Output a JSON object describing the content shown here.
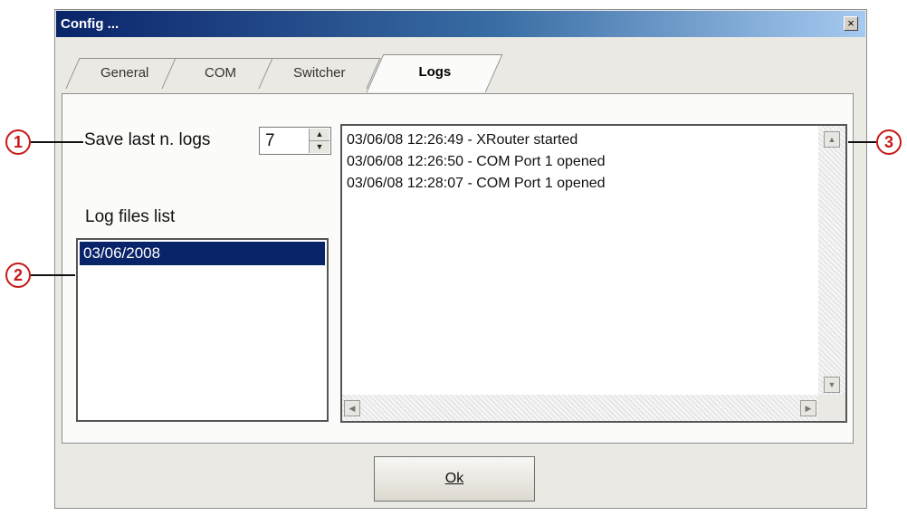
{
  "window": {
    "title": "Config ...",
    "close_glyph": "×"
  },
  "tabs": [
    {
      "label": "General",
      "active": false
    },
    {
      "label": "COM",
      "active": false
    },
    {
      "label": "Switcher",
      "active": false
    },
    {
      "label": "Logs",
      "active": true
    }
  ],
  "logs_tab": {
    "save_last_label": "Save last n. logs",
    "save_last_value": "7",
    "log_files_label": "Log files list",
    "log_files": [
      {
        "label": "03/06/2008",
        "selected": true
      }
    ],
    "log_lines": [
      "03/06/08 12:26:49 - XRouter started",
      "03/06/08 12:26:50 - COM Port 1 opened",
      "03/06/08 12:28:07 - COM Port 1 opened"
    ]
  },
  "callouts": [
    "1",
    "2",
    "3"
  ],
  "footer": {
    "ok_label": "Ok"
  },
  "colors": {
    "title_gradient_start": "#0a246a",
    "selection": "#0a246a",
    "callout": "#c81818"
  },
  "icons": {
    "close": "close-icon",
    "spin_up": "triangle-up-icon",
    "spin_down": "triangle-down-icon",
    "scroll_up": "scroll-up-icon",
    "scroll_down": "scroll-down-icon",
    "scroll_left": "scroll-left-icon",
    "scroll_right": "scroll-right-icon"
  }
}
